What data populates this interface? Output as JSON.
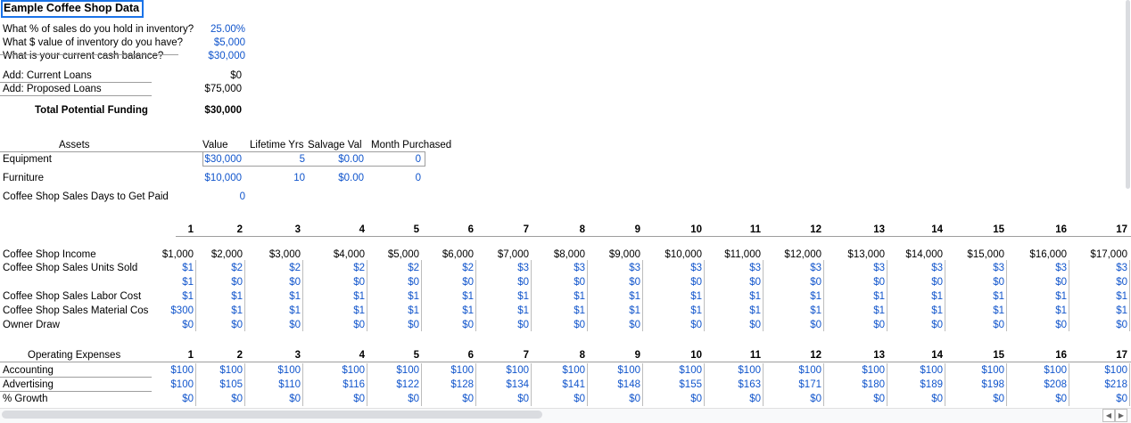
{
  "title": "Eample Coffee Shop Data",
  "assumptions": [
    {
      "label": "What % of sales do you hold in inventory?",
      "value": "25.00%"
    },
    {
      "label": "What $ value of inventory do you have?",
      "value": "$5,000"
    },
    {
      "label": "What is your current cash balance?",
      "value": "$30,000"
    }
  ],
  "loans": [
    {
      "label": "Add: Current Loans",
      "value": "$0"
    },
    {
      "label": "Add: Proposed Loans",
      "value": "$75,000"
    }
  ],
  "total": {
    "label": "Total  Potential Funding",
    "value": "$30,000"
  },
  "assets": {
    "headers": [
      "Assets",
      "Value",
      "Lifetime Yrs",
      "Salvage Val",
      "Month Purchased"
    ],
    "rows": [
      {
        "label": "Equipment",
        "value": "$30,000",
        "life": "5",
        "salvage": "$0.00",
        "month": "0"
      },
      {
        "label": "Furniture",
        "value": "$10,000",
        "life": "10",
        "salvage": "$0.00",
        "month": "0"
      }
    ],
    "days_label": "Coffee Shop Sales Days to Get Paid",
    "days_value": "0"
  },
  "months": [
    "1",
    "2",
    "3",
    "4",
    "5",
    "6",
    "7",
    "8",
    "9",
    "10",
    "11",
    "12",
    "13",
    "14",
    "15",
    "16",
    "17"
  ],
  "income_rows": [
    {
      "label": "Coffee Shop Income",
      "values": [
        "$1,000",
        "$2,000",
        "$3,000",
        "$4,000",
        "$5,000",
        "$6,000",
        "$7,000",
        "$8,000",
        "$9,000",
        "$10,000",
        "$11,000",
        "$12,000",
        "$13,000",
        "$14,000",
        "$15,000",
        "$16,000",
        "$17,000"
      ]
    },
    {
      "label": "Coffee Shop Sales Units Sold",
      "values": [
        "$1",
        "$2",
        "$2",
        "$2",
        "$2",
        "$2",
        "$3",
        "$3",
        "$3",
        "$3",
        "$3",
        "$3",
        "$3",
        "$3",
        "$3",
        "$3",
        "$3"
      ]
    },
    {
      "label": "",
      "values": [
        "$1",
        "$0",
        "$0",
        "$0",
        "$0",
        "$0",
        "$0",
        "$0",
        "$0",
        "$0",
        "$0",
        "$0",
        "$0",
        "$0",
        "$0",
        "$0",
        "$0"
      ]
    },
    {
      "label": "Coffee Shop Sales Labor Cost",
      "values": [
        "$1",
        "$1",
        "$1",
        "$1",
        "$1",
        "$1",
        "$1",
        "$1",
        "$1",
        "$1",
        "$1",
        "$1",
        "$1",
        "$1",
        "$1",
        "$1",
        "$1"
      ]
    },
    {
      "label": "Coffee Shop Sales Material Cos",
      "values": [
        "$300",
        "$1",
        "$1",
        "$1",
        "$1",
        "$1",
        "$1",
        "$1",
        "$1",
        "$1",
        "$1",
        "$1",
        "$1",
        "$1",
        "$1",
        "$1",
        "$1"
      ]
    },
    {
      "label": "Owner Draw",
      "values": [
        "$0",
        "$0",
        "$0",
        "$0",
        "$0",
        "$0",
        "$0",
        "$0",
        "$0",
        "$0",
        "$0",
        "$0",
        "$0",
        "$0",
        "$0",
        "$0",
        "$0"
      ]
    }
  ],
  "opex_header": "Operating Expenses",
  "opex_rows": [
    {
      "label": "Accounting",
      "values": [
        "$100",
        "$100",
        "$100",
        "$100",
        "$100",
        "$100",
        "$100",
        "$100",
        "$100",
        "$100",
        "$100",
        "$100",
        "$100",
        "$100",
        "$100",
        "$100",
        "$100"
      ]
    },
    {
      "label": "Advertising",
      "values": [
        "$100",
        "$105",
        "$110",
        "$116",
        "$122",
        "$128",
        "$134",
        "$141",
        "$148",
        "$155",
        "$163",
        "$171",
        "$180",
        "$189",
        "$198",
        "$208",
        "$218"
      ]
    },
    {
      "label": "% Growth",
      "values": [
        "$0",
        "$0",
        "$0",
        "$0",
        "$0",
        "$0",
        "$0",
        "$0",
        "$0",
        "$0",
        "$0",
        "$0",
        "$0",
        "$0",
        "$0",
        "$0",
        "$0"
      ]
    }
  ],
  "colors": {
    "input_blue": "#1155cc",
    "selection": "#1a73e8"
  }
}
